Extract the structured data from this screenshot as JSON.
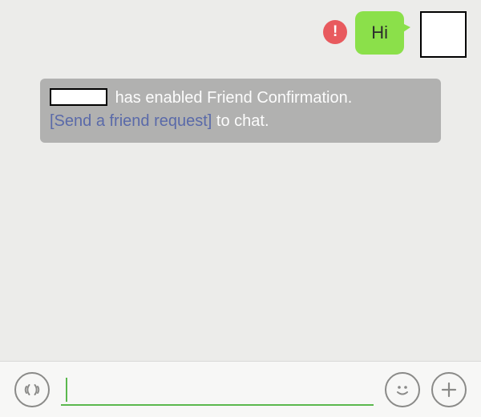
{
  "message": {
    "text": "Hi",
    "alert_glyph": "!"
  },
  "system_banner": {
    "text_before_link": "has enabled Friend Confirmation.",
    "link_text": "[Send a friend request]",
    "text_after_link": "to chat."
  },
  "colors": {
    "bubble": "#8be04a",
    "alert": "#e85a5e",
    "link": "#5a6aa9",
    "accent": "#5bb84e"
  }
}
